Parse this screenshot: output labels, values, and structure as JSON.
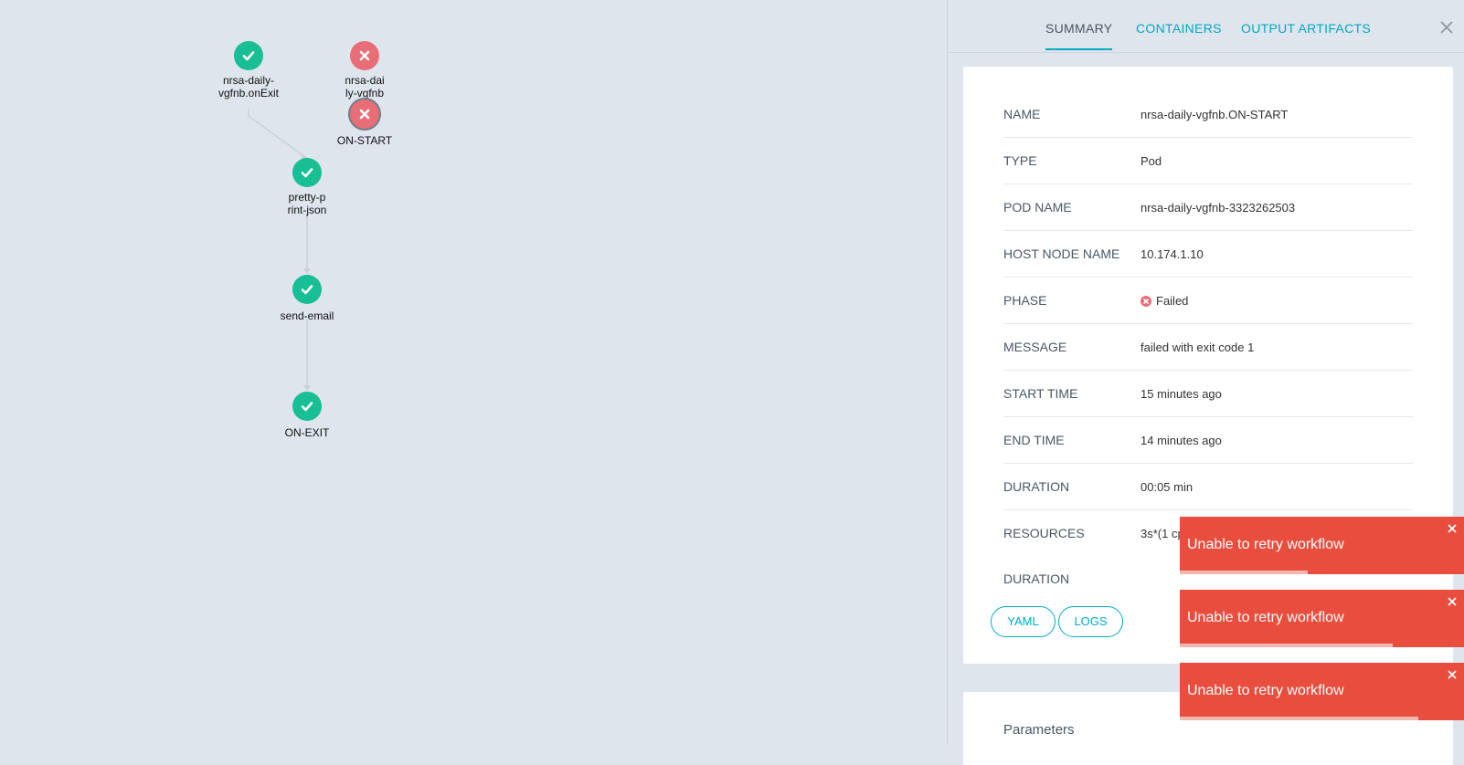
{
  "graph": {
    "nodes": [
      {
        "id": "onexit-handler",
        "label": "nrsa-daily-\nvgfnb.onExit",
        "status": "succeeded"
      },
      {
        "id": "workflow-root",
        "label": "nrsa-dai\nly-vgfnb",
        "status": "failed"
      },
      {
        "id": "on-start",
        "label": "ON-START",
        "status": "failed",
        "selected": true
      },
      {
        "id": "pretty-print-json",
        "label": "pretty-p\nrint-json",
        "status": "succeeded"
      },
      {
        "id": "send-email",
        "label": "send-email",
        "status": "succeeded"
      },
      {
        "id": "on-exit",
        "label": "ON-EXIT",
        "status": "succeeded"
      }
    ],
    "colors": {
      "succeeded": "#18be94",
      "failed": "#e96d76",
      "edge": "#c9d1d8"
    }
  },
  "panel": {
    "tabs": [
      {
        "label": "SUMMARY",
        "active": true
      },
      {
        "label": "CONTAINERS",
        "active": false
      },
      {
        "label": "OUTPUT ARTIFACTS",
        "active": false
      }
    ],
    "summary": {
      "rows": [
        {
          "key": "NAME",
          "value": "nrsa-daily-vgfnb.ON-START"
        },
        {
          "key": "TYPE",
          "value": "Pod"
        },
        {
          "key": "POD NAME",
          "value": "nrsa-daily-vgfnb-3323262503"
        },
        {
          "key": "HOST NODE NAME",
          "value": "10.174.1.10"
        },
        {
          "key": "PHASE",
          "value": "Failed"
        },
        {
          "key": "MESSAGE",
          "value": "failed with exit code 1"
        },
        {
          "key": "START TIME",
          "value": "15 minutes ago"
        },
        {
          "key": "END TIME",
          "value": "14 minutes ago"
        },
        {
          "key": "DURATION",
          "value": "00:05 min"
        },
        {
          "key": "RESOURCES",
          "value": "3s*(1 cp"
        },
        {
          "key": "DURATION",
          "value": ""
        }
      ],
      "buttons": {
        "yaml": "YAML",
        "logs": "LOGS"
      }
    },
    "parameters_title": "Parameters"
  },
  "toasts": [
    {
      "message": "Unable to retry workflow",
      "progress": 0.45
    },
    {
      "message": "Unable to retry workflow",
      "progress": 0.75
    },
    {
      "message": "Unable to retry workflow",
      "progress": 0.84
    }
  ],
  "accent": "#00a9c2",
  "toast_color": "#e94d3d"
}
